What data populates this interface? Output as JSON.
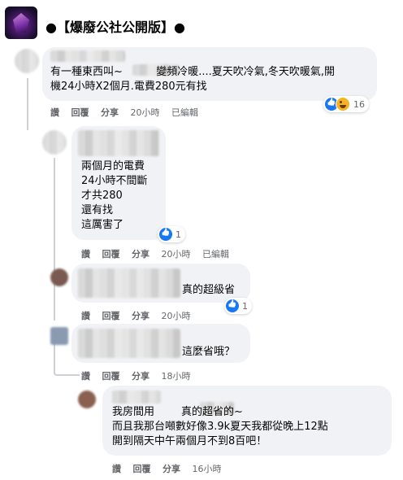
{
  "header": {
    "title": "●【爆廢公社公開版】●"
  },
  "comments": [
    {
      "text": "有一種東西叫~          變頻冷暖....夏天吹冷氣,冬天吹暖氣,開\n機24小時X2個月.電費280元有找",
      "actions": [
        "讚",
        "回覆",
        "分享",
        "20小時",
        "已編輯"
      ],
      "reactions": "16"
    },
    {
      "text": "兩個月的電費\n24小時不間斷\n才共280\n還有找\n這厲害了",
      "actions": [
        "讚",
        "回覆",
        "分享",
        "20小時",
        "已編輯"
      ],
      "reactions": "1"
    },
    {
      "text": "真的超級省",
      "actions": [
        "讚",
        "回覆",
        "分享",
        "20小時"
      ],
      "reactions": "1"
    },
    {
      "text": "這麼省哦？",
      "actions": [
        "讚",
        "回覆",
        "分享",
        "18小時"
      ]
    },
    {
      "text": "我房間用        真的超省的~\n而且我那台噸數好像3.9k夏天我都從晚上12點\n開到隔天中午兩個月不到8百吧！",
      "actions": [
        "讚",
        "回覆",
        "分享",
        "16小時"
      ]
    }
  ]
}
